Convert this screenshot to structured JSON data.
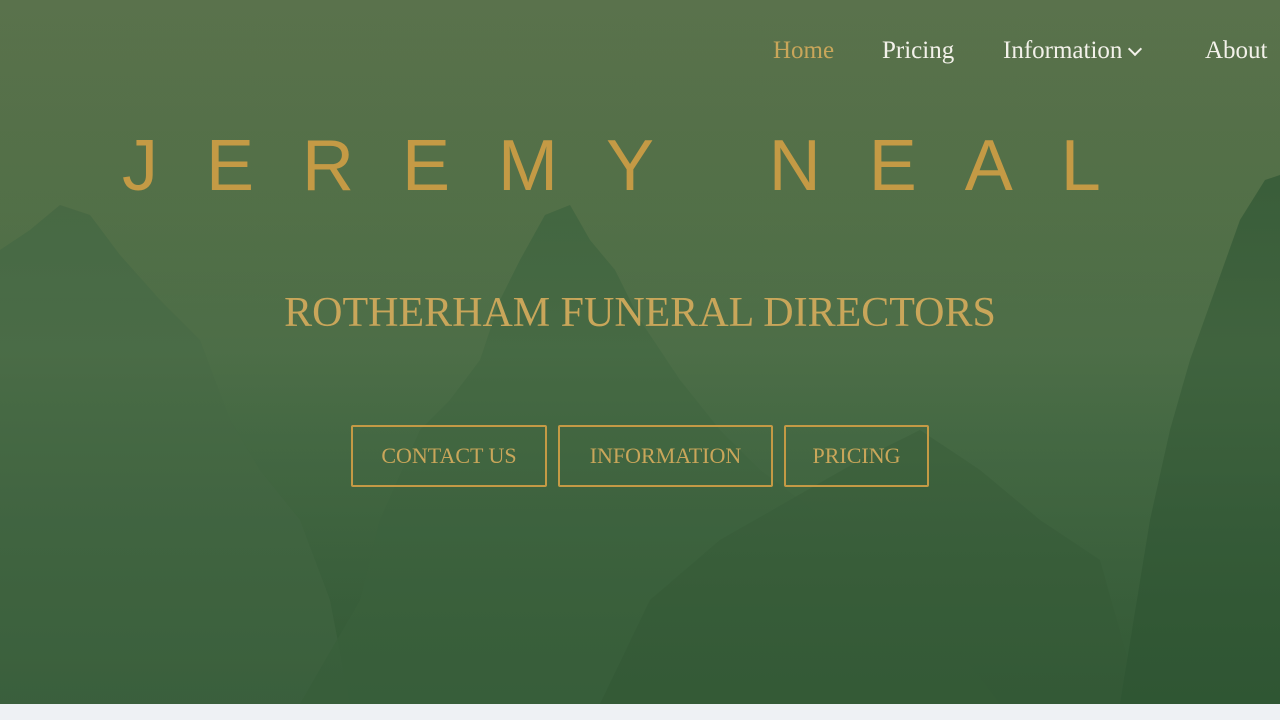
{
  "nav": {
    "items": [
      {
        "label": "Home",
        "active": true
      },
      {
        "label": "Pricing",
        "active": false
      },
      {
        "label": "Information",
        "active": false,
        "has_dropdown": true
      },
      {
        "label": "About",
        "active": false
      }
    ]
  },
  "hero": {
    "brand": "JEREMY NEAL",
    "subtitle": "ROTHERHAM FUNERAL DIRECTORS",
    "buttons": [
      {
        "label": "CONTACT US"
      },
      {
        "label": "INFORMATION"
      },
      {
        "label": "PRICING"
      }
    ]
  },
  "colors": {
    "accent": "#c49a45",
    "nav_text": "#f3f1ea",
    "background_green": "#4f6d45"
  },
  "icons": {
    "dropdown": "chevron-down-icon"
  }
}
